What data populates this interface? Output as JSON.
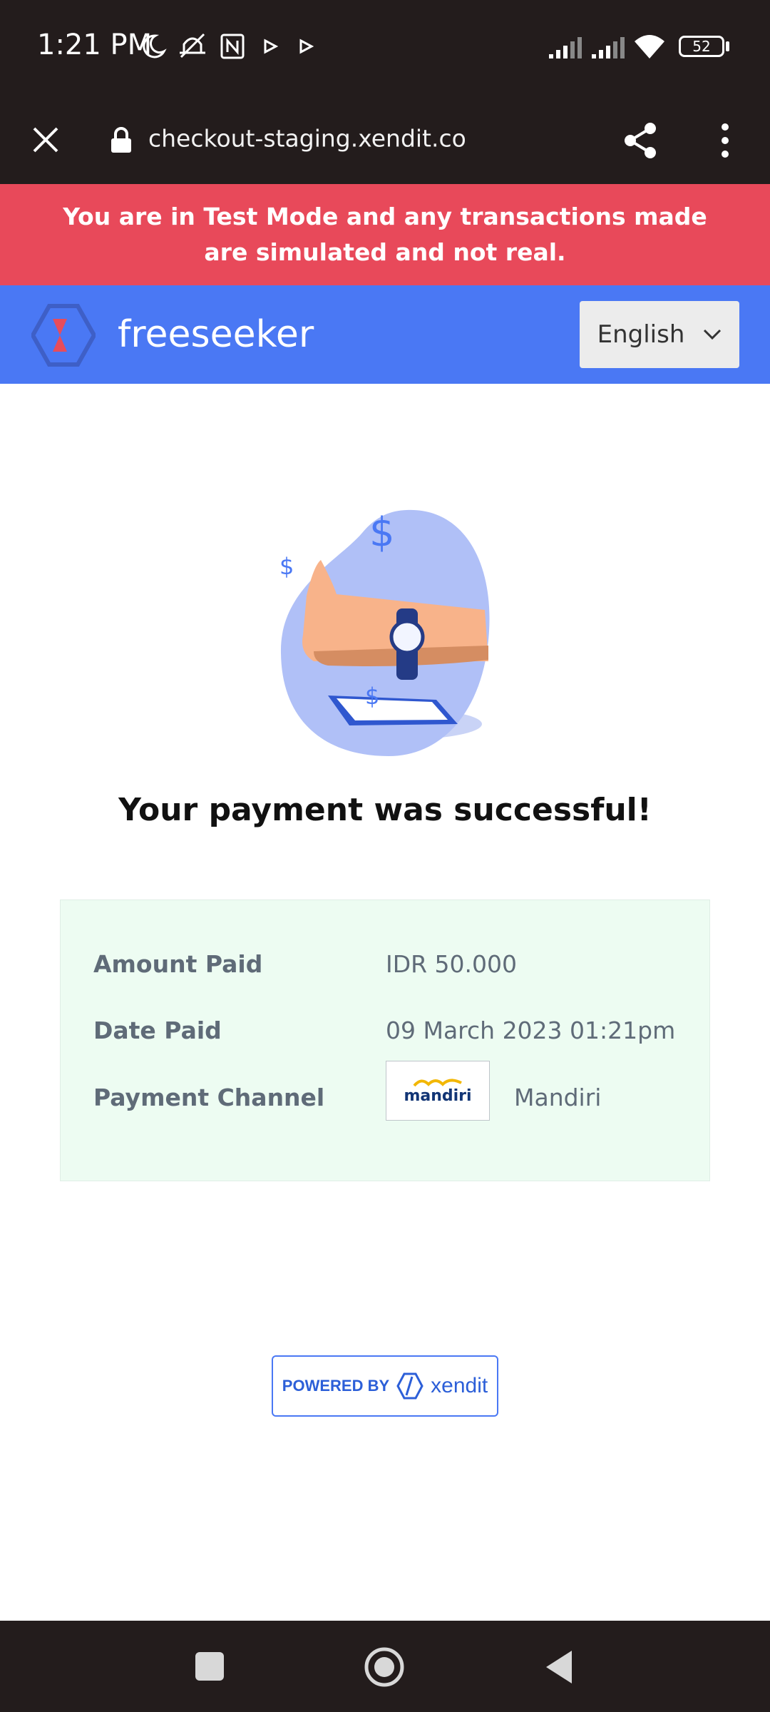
{
  "status_bar": {
    "time": "1:21 PM",
    "battery": "52",
    "icons": [
      "moon-icon",
      "mute-icon",
      "nfc-icon",
      "play-icon",
      "play-icon",
      "signal-icon",
      "signal-icon",
      "wifi-icon",
      "battery-icon"
    ]
  },
  "browser": {
    "url": "checkout-staging.xendit.co",
    "icons": [
      "close-icon",
      "lock-icon",
      "share-icon",
      "more-vert-icon"
    ]
  },
  "test_banner": "You are in Test Mode and any transactions made are simulated and not real.",
  "header": {
    "merchant_name": "freeseeker",
    "language": "English",
    "colors": {
      "banner": "#e8495a",
      "header": "#4a78f4"
    }
  },
  "success_message": "Your payment was successful!",
  "payment": {
    "amount_label": "Amount Paid",
    "amount_value": "IDR 50.000",
    "date_label": "Date Paid",
    "date_value": "09 March 2023 01:21pm",
    "channel_label": "Payment Channel",
    "channel_logo_text": "mandiri",
    "channel_value": "Mandiri"
  },
  "powered_by": {
    "label": "POWERED BY",
    "brand": "xendit"
  },
  "nav": [
    "recents-button",
    "home-button",
    "back-button"
  ]
}
